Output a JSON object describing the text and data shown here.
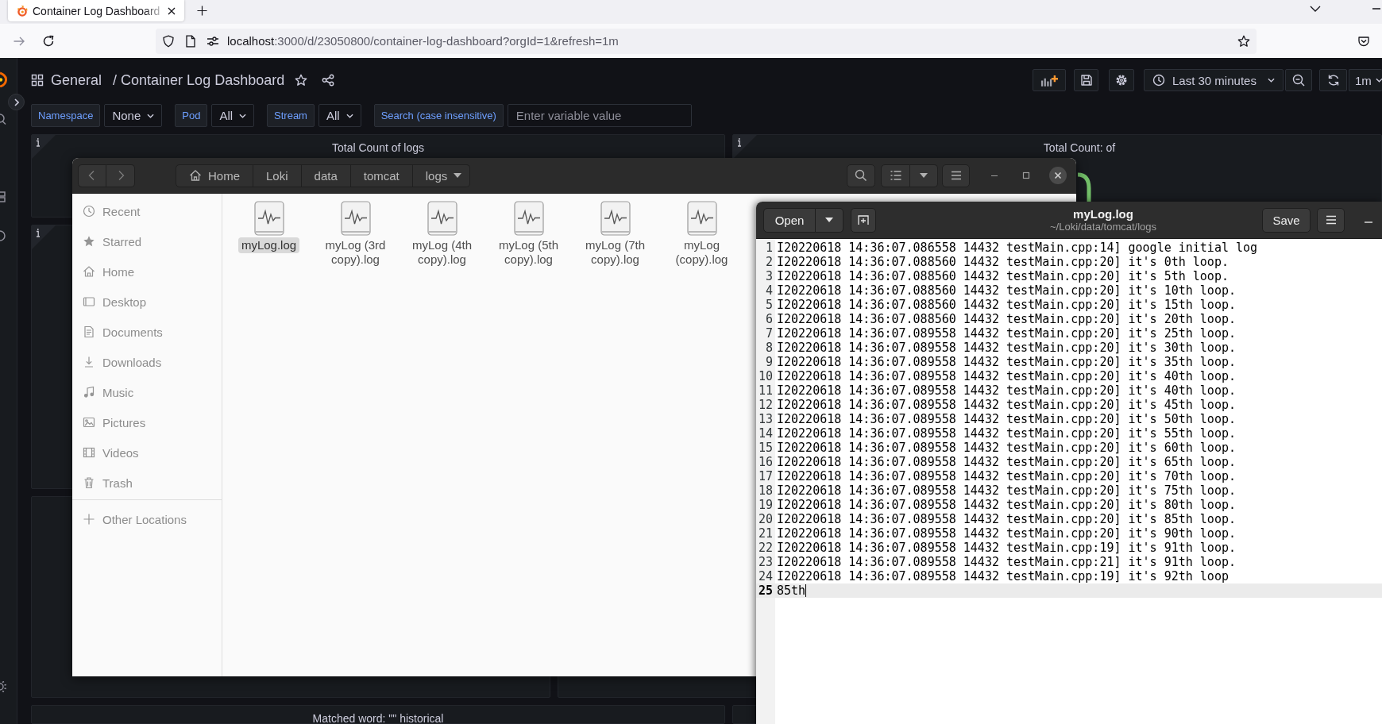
{
  "browser": {
    "tabs": [
      {
        "title": "Container Log Dashboard",
        "selected": true
      }
    ],
    "url": {
      "host": "localhost",
      "path": ":3000/d/23050800/container-log-dashboard?orgId=1&refresh=1m"
    }
  },
  "dashboard": {
    "folder": "General",
    "separator": "/",
    "title": "Container Log Dashboard",
    "time_range": "Last 30 minutes",
    "refresh_interval": "1m",
    "variables": [
      {
        "label": "Namespace",
        "kind": "select",
        "value": "None"
      },
      {
        "label": "Pod",
        "kind": "select",
        "value": "All"
      },
      {
        "label": "Stream",
        "kind": "select",
        "value": "All"
      },
      {
        "label": "Search (case insensitive)",
        "kind": "text",
        "placeholder": "Enter variable value"
      }
    ],
    "panels": [
      {
        "title": "Total Count of logs",
        "info": true
      },
      {
        "title": "Total Count: of",
        "info": true
      },
      {
        "info": true
      },
      {
        "title": "Matched word: \"\" historical",
        "info": false
      }
    ]
  },
  "file_manager": {
    "path": [
      {
        "label": "Home",
        "kind": "home"
      },
      {
        "label": "Loki",
        "kind": "folder"
      },
      {
        "label": "data",
        "kind": "folder"
      },
      {
        "label": "tomcat",
        "kind": "folder"
      },
      {
        "label": "logs",
        "kind": "current"
      }
    ],
    "places": [
      {
        "label": "Recent",
        "kind": "recent"
      },
      {
        "label": "Starred",
        "kind": "starred"
      },
      {
        "label": "Home",
        "kind": "home"
      },
      {
        "label": "Desktop",
        "kind": "desktop"
      },
      {
        "label": "Documents",
        "kind": "documents"
      },
      {
        "label": "Downloads",
        "kind": "downloads"
      },
      {
        "label": "Music",
        "kind": "music"
      },
      {
        "label": "Pictures",
        "kind": "pictures"
      },
      {
        "label": "Videos",
        "kind": "videos"
      },
      {
        "label": "Trash",
        "kind": "trash"
      }
    ],
    "other_locations": "Other Locations",
    "files": [
      {
        "name": "myLog.log",
        "selected": true
      },
      {
        "name": "myLog (3rd copy).log",
        "selected": false
      },
      {
        "name": "myLog (4th copy).log",
        "selected": false
      },
      {
        "name": "myLog (5th copy).log",
        "selected": false
      },
      {
        "name": "myLog (7th copy).log",
        "selected": false
      },
      {
        "name": "myLog (copy).log",
        "selected": false
      }
    ]
  },
  "editor": {
    "open_label": "Open",
    "title": "myLog.log",
    "subtitle": "~/Loki/data/tomcat/logs",
    "save_label": "Save",
    "lines": [
      {
        "number": "1",
        "text": "I20220618 14:36:07.086558 14432 testMain.cpp:14] google initial log",
        "current": false
      },
      {
        "number": "2",
        "text": "I20220618 14:36:07.088560 14432 testMain.cpp:20] it's 0th loop.",
        "current": false
      },
      {
        "number": "3",
        "text": "I20220618 14:36:07.088560 14432 testMain.cpp:20] it's 5th loop.",
        "current": false
      },
      {
        "number": "4",
        "text": "I20220618 14:36:07.088560 14432 testMain.cpp:20] it's 10th loop.",
        "current": false
      },
      {
        "number": "5",
        "text": "I20220618 14:36:07.088560 14432 testMain.cpp:20] it's 15th loop.",
        "current": false
      },
      {
        "number": "6",
        "text": "I20220618 14:36:07.088560 14432 testMain.cpp:20] it's 20th loop.",
        "current": false
      },
      {
        "number": "7",
        "text": "I20220618 14:36:07.089558 14432 testMain.cpp:20] it's 25th loop.",
        "current": false
      },
      {
        "number": "8",
        "text": "I20220618 14:36:07.089558 14432 testMain.cpp:20] it's 30th loop.",
        "current": false
      },
      {
        "number": "9",
        "text": "I20220618 14:36:07.089558 14432 testMain.cpp:20] it's 35th loop.",
        "current": false
      },
      {
        "number": "10",
        "text": "I20220618 14:36:07.089558 14432 testMain.cpp:20] it's 40th loop.",
        "current": false
      },
      {
        "number": "11",
        "text": "I20220618 14:36:07.089558 14432 testMain.cpp:20] it's 40th loop.",
        "current": false
      },
      {
        "number": "12",
        "text": "I20220618 14:36:07.089558 14432 testMain.cpp:20] it's 45th loop.",
        "current": false
      },
      {
        "number": "13",
        "text": "I20220618 14:36:07.089558 14432 testMain.cpp:20] it's 50th loop.",
        "current": false
      },
      {
        "number": "14",
        "text": "I20220618 14:36:07.089558 14432 testMain.cpp:20] it's 55th loop.",
        "current": false
      },
      {
        "number": "15",
        "text": "I20220618 14:36:07.089558 14432 testMain.cpp:20] it's 60th loop.",
        "current": false
      },
      {
        "number": "16",
        "text": "I20220618 14:36:07.089558 14432 testMain.cpp:20] it's 65th loop.",
        "current": false
      },
      {
        "number": "17",
        "text": "I20220618 14:36:07.089558 14432 testMain.cpp:20] it's 70th loop.",
        "current": false
      },
      {
        "number": "18",
        "text": "I20220618 14:36:07.089558 14432 testMain.cpp:20] it's 75th loop.",
        "current": false
      },
      {
        "number": "19",
        "text": "I20220618 14:36:07.089558 14432 testMain.cpp:20] it's 80th loop.",
        "current": false
      },
      {
        "number": "20",
        "text": "I20220618 14:36:07.089558 14432 testMain.cpp:20] it's 85th loop.",
        "current": false
      },
      {
        "number": "21",
        "text": "I20220618 14:36:07.089558 14432 testMain.cpp:20] it's 90th loop.",
        "current": false
      },
      {
        "number": "22",
        "text": "I20220618 14:36:07.089558 14432 testMain.cpp:19] it's 91th loop.",
        "current": false
      },
      {
        "number": "23",
        "text": "I20220618 14:36:07.089558 14432 testMain.cpp:21] it's 91th loop.",
        "current": false
      },
      {
        "number": "24",
        "text": "I20220618 14:36:07.089558 14432 testMain.cpp:19] it's 92th loop",
        "current": false
      },
      {
        "number": "25",
        "text": "85th",
        "current": true
      }
    ]
  }
}
